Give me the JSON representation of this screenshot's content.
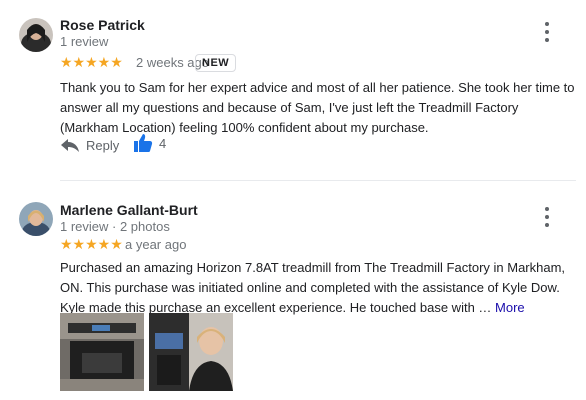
{
  "reviews": [
    {
      "name": "Rose Patrick",
      "meta": "1 review",
      "stars": "★★★★★",
      "time": "2 weeks ago",
      "badge": "NEW",
      "text": "Thank you to Sam for her expert advice and most of all her patience. She took her time to answer all my questions and because of Sam, I've just left the Treadmill Factory (Markham Location) feeling 100% confident about my purchase.",
      "reply_label": "Reply",
      "like_count": "4"
    },
    {
      "name": "Marlene Gallant-Burt",
      "meta": "1 review · 2 photos",
      "stars": "★★★★★",
      "time": "a year ago",
      "text": "Purchased an amazing Horizon 7.8AT treadmill from The Treadmill Factory in Markham, ON. This purchase was initiated online and completed with the assistance of Kyle Dow. Kyle made this purchase an excellent experience. He touched base with …",
      "more_label": "More"
    }
  ],
  "icons": {
    "menu": "more-vert-icon",
    "reply": "reply-arrow-icon",
    "like": "thumbs-up-icon"
  },
  "colors": {
    "star": "#f5a623",
    "like": "#1a73e8",
    "link": "#1a0dab"
  }
}
